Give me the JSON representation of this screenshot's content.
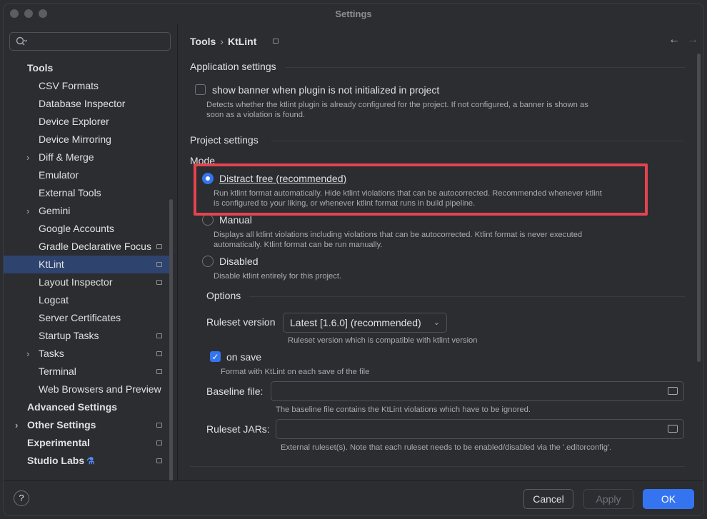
{
  "window": {
    "title": "Settings"
  },
  "search": {
    "icon": "search-icon",
    "placeholder": ""
  },
  "sidebar": {
    "items": [
      {
        "label": "Tools",
        "bold": true,
        "indent": 0,
        "chevron": false,
        "pin": false
      },
      {
        "label": "CSV Formats",
        "indent": 1,
        "chevron": false,
        "pin": false
      },
      {
        "label": "Database Inspector",
        "indent": 1,
        "chevron": false,
        "pin": false
      },
      {
        "label": "Device Explorer",
        "indent": 1,
        "chevron": false,
        "pin": false
      },
      {
        "label": "Device Mirroring",
        "indent": 1,
        "chevron": false,
        "pin": false
      },
      {
        "label": "Diff & Merge",
        "indent": 1,
        "chevron": true,
        "pin": false
      },
      {
        "label": "Emulator",
        "indent": 1,
        "chevron": false,
        "pin": false
      },
      {
        "label": "External Tools",
        "indent": 1,
        "chevron": false,
        "pin": false
      },
      {
        "label": "Gemini",
        "indent": 1,
        "chevron": true,
        "pin": false
      },
      {
        "label": "Google Accounts",
        "indent": 1,
        "chevron": false,
        "pin": false
      },
      {
        "label": "Gradle Declarative Focus",
        "indent": 1,
        "chevron": false,
        "pin": true
      },
      {
        "label": "KtLint",
        "indent": 1,
        "chevron": false,
        "pin": true,
        "selected": true
      },
      {
        "label": "Layout Inspector",
        "indent": 1,
        "chevron": false,
        "pin": true
      },
      {
        "label": "Logcat",
        "indent": 1,
        "chevron": false,
        "pin": false
      },
      {
        "label": "Server Certificates",
        "indent": 1,
        "chevron": false,
        "pin": false
      },
      {
        "label": "Startup Tasks",
        "indent": 1,
        "chevron": false,
        "pin": true
      },
      {
        "label": "Tasks",
        "indent": 1,
        "chevron": true,
        "pin": true
      },
      {
        "label": "Terminal",
        "indent": 1,
        "chevron": false,
        "pin": true
      },
      {
        "label": "Web Browsers and Preview",
        "indent": 1,
        "chevron": false,
        "pin": false
      },
      {
        "label": "Advanced Settings",
        "bold": true,
        "indent": 0,
        "chevron": false,
        "pin": false
      },
      {
        "label": "Other Settings",
        "bold": true,
        "indent": 0,
        "chevron": true,
        "pin": true
      },
      {
        "label": "Experimental",
        "bold": true,
        "indent": 0,
        "chevron": false,
        "pin": true
      },
      {
        "label": "Studio Labs",
        "bold": true,
        "indent": 0,
        "chevron": false,
        "pin": true,
        "flask": true
      }
    ]
  },
  "breadcrumb": {
    "parent": "Tools",
    "separator": "›",
    "current": "KtLint"
  },
  "nav": {
    "back": "←",
    "forward": "→"
  },
  "app_settings": {
    "heading": "Application settings",
    "banner_label": "show banner when plugin is not initialized in project",
    "banner_checked": false,
    "banner_hint_1": "Detects whether the ktlint plugin is already configured for the project. If not configured, a banner is shown as",
    "banner_hint_2": "soon as a violation is found."
  },
  "project_settings": {
    "heading": "Project settings",
    "mode_label": "Mode",
    "modes": [
      {
        "label": "Distract free (recommended)",
        "selected": true,
        "hint_1": "Run ktlint format automatically. Hide ktlint violations that can be autocorrected. Recommended whenever ktlint",
        "hint_2": "is configured to your liking, or whenever ktlint format runs in build pipeline."
      },
      {
        "label": "Manual",
        "selected": false,
        "hint_1": "Displays all ktlint violations including violations that can be autocorrected. Ktlint format is never executed",
        "hint_2": "automatically. Ktlint format can be run manually."
      },
      {
        "label": "Disabled",
        "selected": false,
        "hint_1": "Disable ktlint entirely for this project."
      }
    ],
    "options_heading": "Options",
    "ruleset_version_label": "Ruleset version",
    "ruleset_version_value": "Latest [1.6.0] (recommended)",
    "ruleset_version_hint": "Ruleset version which is compatible with ktlint version",
    "on_save_label": "on save",
    "on_save_checked": true,
    "on_save_hint": "Format with KtLint on each save of the file",
    "baseline_label": "Baseline file:",
    "baseline_value": "",
    "baseline_hint": "The baseline file contains the KtLint violations which have to be ignored.",
    "jars_label": "Ruleset JARs:",
    "jars_value": "",
    "jars_hint": "External ruleset(s). Note that each ruleset needs to be enabled/disabled via the '.editorconfig'."
  },
  "footer": {
    "help": "?",
    "cancel": "Cancel",
    "apply": "Apply",
    "ok": "OK"
  },
  "colors": {
    "accent": "#3574f0",
    "highlight": "#e5434f",
    "selection": "#2e436e"
  }
}
